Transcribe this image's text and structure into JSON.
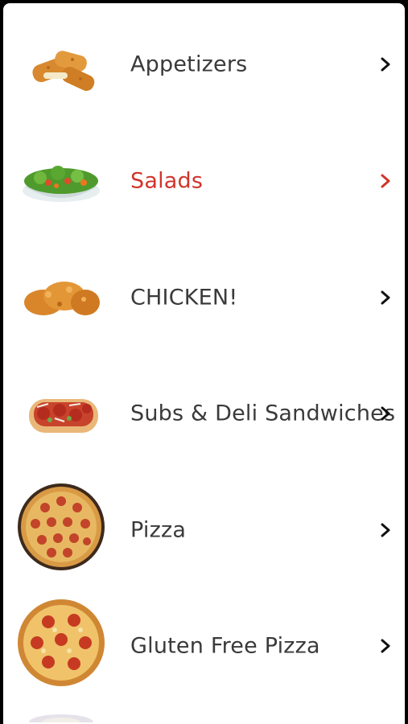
{
  "menu": {
    "items": [
      {
        "label": "Appetizers",
        "icon": "mozzarella-sticks-icon",
        "active": false
      },
      {
        "label": "Salads",
        "icon": "salad-bowl-icon",
        "active": true
      },
      {
        "label": "CHICKEN!",
        "icon": "fried-chicken-icon",
        "active": false
      },
      {
        "label": "Subs & Deli Sandwiches",
        "icon": "sub-sandwich-icon",
        "active": false
      },
      {
        "label": "Pizza",
        "icon": "pepperoni-pizza-icon",
        "active": false
      },
      {
        "label": "Gluten Free Pizza",
        "icon": "gluten-free-pizza-icon",
        "active": false
      }
    ]
  },
  "colors": {
    "text": "#3a3a3a",
    "active": "#d0342c",
    "chevron": "#111111"
  }
}
